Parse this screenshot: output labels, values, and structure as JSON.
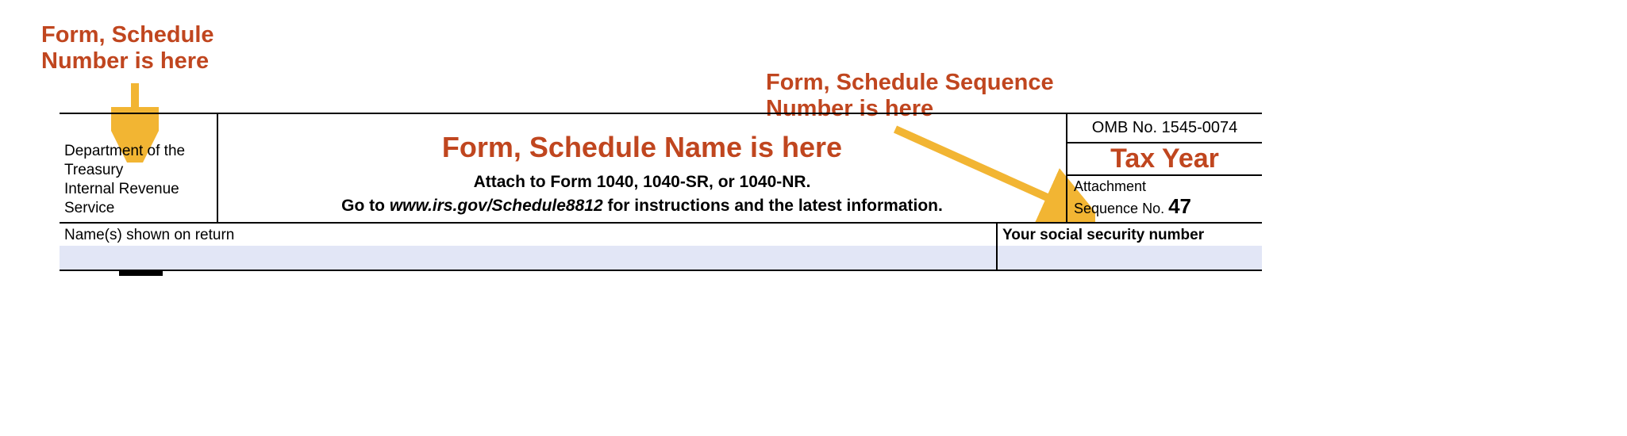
{
  "annotations": {
    "form_number": "Form, Schedule\nNumber is here",
    "form_name": "Form, Schedule Name is here",
    "sequence_number": "Form, Schedule Sequence\nNumber is here",
    "tax_year": "Tax Year"
  },
  "form": {
    "dept_line1": "Department of the Treasury",
    "dept_line2": "Internal Revenue Service",
    "attach_line": "Attach to Form 1040, 1040-SR, or 1040-NR.",
    "goto_prefix": "Go to ",
    "goto_url": "www.irs.gov/Schedule8812",
    "goto_suffix": " for instructions and the latest information.",
    "omb": "OMB No. 1545-0074",
    "attachment_label": "Attachment",
    "sequence_label": "Sequence No. ",
    "sequence_value": "47",
    "names_label": "Name(s) shown on return",
    "ssn_label": "Your social security number"
  }
}
